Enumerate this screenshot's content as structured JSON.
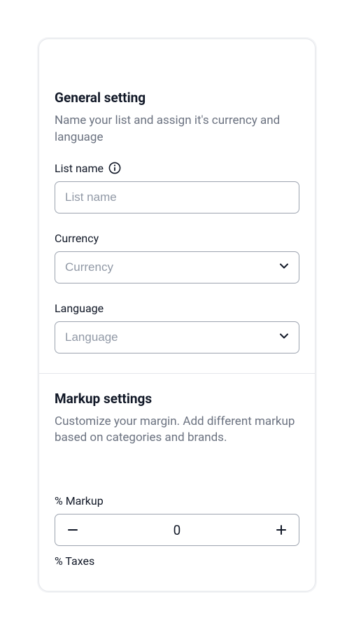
{
  "general": {
    "title": "General setting",
    "subtitle": "Name your list and assign it's currency and language",
    "listName": {
      "label": "List name",
      "placeholder": "List name",
      "value": ""
    },
    "currency": {
      "label": "Currency",
      "placeholder": "Currency",
      "value": ""
    },
    "language": {
      "label": "Language",
      "placeholder": "Language",
      "value": ""
    }
  },
  "markup": {
    "title": "Markup settings",
    "subtitle": "Customize your margin. Add different markup based on categories and brands.",
    "percentMarkup": {
      "label": "% Markup",
      "value": "0"
    },
    "percentTaxes": {
      "label": "% Taxes"
    }
  }
}
